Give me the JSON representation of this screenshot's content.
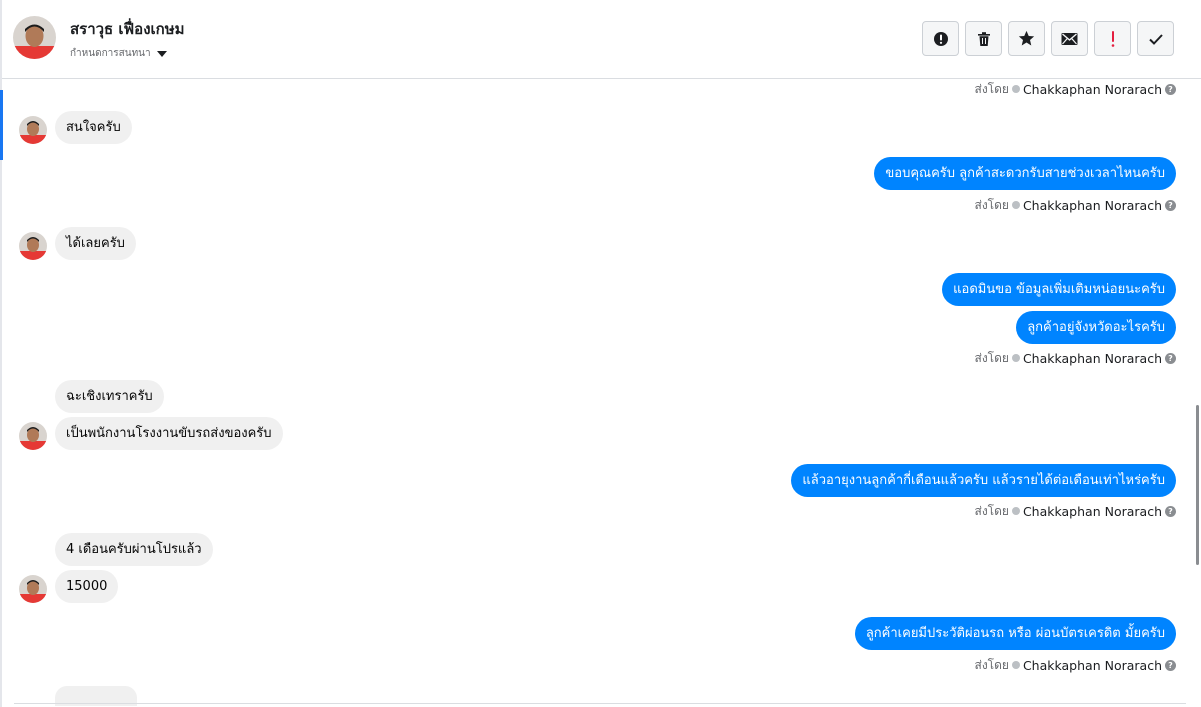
{
  "header": {
    "contact_name": "สราวุธ เฟื่องเกษม",
    "sub_label": "กำหนดการสนทนา",
    "avatar_icon": "person-avatar-icon",
    "toolbar": [
      {
        "name": "spam-button",
        "icon": "alert-circle-icon"
      },
      {
        "name": "delete-button",
        "icon": "trash-icon"
      },
      {
        "name": "star-button",
        "icon": "star-icon"
      },
      {
        "name": "mark-unread-button",
        "icon": "envelope-icon"
      },
      {
        "name": "follow-up-button",
        "icon": "exclamation-icon"
      },
      {
        "name": "mark-done-button",
        "icon": "checkmark-icon"
      }
    ]
  },
  "sent_by_prefix": "ส่งโดย",
  "sender_name": "Chakkaphan Norarach",
  "help_glyph": "?",
  "messages": [
    {
      "dir": "in",
      "text": "สนใจครับ"
    },
    {
      "dir": "out",
      "text": "ขอบคุณครับ ลูกค้าสะดวกรับสายช่วงเวลาไหนครับ"
    },
    {
      "dir": "in",
      "text": "ได้เลยครับ"
    },
    {
      "dir": "out",
      "text": "แอดมินขอ ข้อมูลเพิ่มเติมหน่อยนะครับ"
    },
    {
      "dir": "out",
      "text": "ลูกค้าอยู่จังหวัดอะไรครับ"
    },
    {
      "dir": "in",
      "text": "ฉะเชิงเทราครับ"
    },
    {
      "dir": "in",
      "text": "เป็นพนักงานโรงงานขับรถส่งของครับ"
    },
    {
      "dir": "out",
      "text": "แล้วอายุงานลูกค้ากี่เดือนแล้วครับ แล้วรายได้ต่อเดือนเท่าไหร่ครับ"
    },
    {
      "dir": "in",
      "text": "4 เดือนครับผ่านโปรแล้ว"
    },
    {
      "dir": "in",
      "text": "15000"
    },
    {
      "dir": "out",
      "text": "ลูกค้าเคยมีประวัติผ่อนรถ หรือ ผ่อนบัตรเครดิต มั้ยครับ"
    }
  ],
  "colors": {
    "outgoing_bubble": "#0084ff",
    "incoming_bubble": "#f0f0f0",
    "accent": "#1877f2"
  }
}
